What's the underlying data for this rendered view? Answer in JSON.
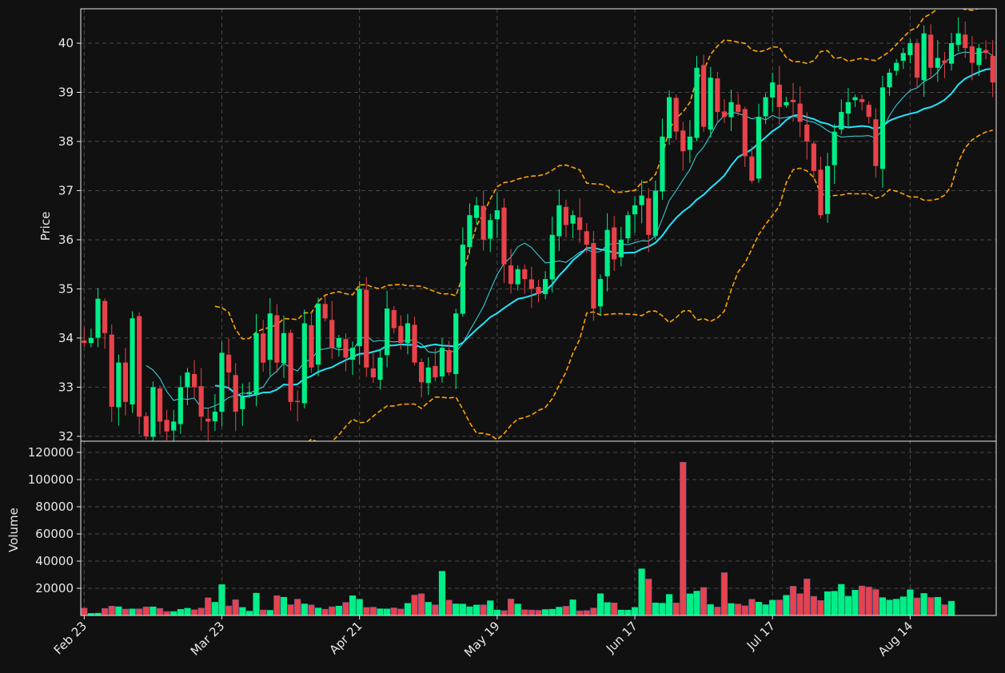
{
  "colors": {
    "background": "#111111",
    "grid": "#4a4a4a",
    "frame": "#e8e8e8",
    "up": "#00ee88",
    "down": "#e8424a",
    "ma_fast": "#39dce4",
    "ma_slow": "#22e6ff",
    "bands": "#ffa500"
  },
  "chart_data": {
    "type": "candlestick",
    "title": "",
    "grid": true,
    "price_panel": {
      "ylabel": "Price",
      "ylim": [
        31.9,
        40.7
      ],
      "yticks": [
        "32",
        "33",
        "34",
        "35",
        "36",
        "37",
        "38",
        "39",
        "40"
      ]
    },
    "volume_panel": {
      "ylabel": "Volume",
      "ylim": [
        0,
        120000
      ],
      "yticks": [
        "20000",
        "40000",
        "60000",
        "80000",
        "100000",
        "120000"
      ]
    },
    "x_ticks": [
      {
        "label": "Feb 23",
        "index": 0
      },
      {
        "label": "Mar 23",
        "index": 20
      },
      {
        "label": "Apr 21",
        "index": 40
      },
      {
        "label": "May 19",
        "index": 60
      },
      {
        "label": "Jun 17",
        "index": 80
      },
      {
        "label": "Jul 17",
        "index": 100
      },
      {
        "label": "Aug 14",
        "index": 120
      }
    ],
    "closes": [
      33.9,
      34.0,
      34.8,
      34.1,
      32.6,
      33.5,
      32.7,
      34.4,
      32.4,
      32.0,
      33.0,
      32.3,
      32.1,
      32.3,
      33.0,
      33.3,
      33.0,
      32.4,
      32.3,
      32.5,
      33.7,
      33.3,
      32.5,
      32.8,
      32.9,
      34.1,
      33.5,
      34.5,
      33.5,
      34.1,
      32.7,
      32.7,
      34.3,
      33.4,
      34.7,
      34.4,
      33.8,
      34.0,
      33.6,
      33.8,
      35.0,
      33.4,
      33.2,
      33.6,
      34.6,
      34.2,
      33.9,
      34.3,
      33.5,
      33.1,
      33.4,
      33.2,
      33.8,
      33.3,
      34.5,
      35.9,
      36.5,
      36.7,
      36.0,
      36.4,
      36.6,
      35.5,
      35.1,
      35.4,
      35.2,
      35.0,
      34.9,
      35.2,
      36.1,
      36.7,
      36.3,
      36.5,
      36.2,
      35.9,
      34.6,
      35.2,
      36.2,
      35.6,
      36.0,
      36.5,
      36.7,
      36.9,
      36.1,
      37.0,
      38.1,
      38.9,
      38.2,
      37.8,
      38.1,
      39.5,
      38.3,
      39.3,
      38.6,
      38.5,
      38.8,
      38.6,
      37.7,
      37.2,
      38.5,
      38.9,
      39.2,
      38.7,
      38.8,
      38.8,
      38.4,
      38.0,
      37.4,
      36.5,
      37.5,
      38.2,
      38.6,
      38.8,
      38.9,
      38.8,
      38.5,
      37.5,
      39.1,
      39.4,
      39.6,
      39.8,
      40.0,
      39.3,
      40.2,
      39.5,
      39.7,
      39.6,
      40.0,
      40.2,
      39.9,
      39.6,
      39.9,
      39.8,
      39.2
    ],
    "volumes": [
      5400,
      1500,
      1700,
      5200,
      6900,
      6400,
      4700,
      4800,
      4900,
      6300,
      6300,
      5200,
      2900,
      2900,
      4500,
      5300,
      4200,
      5400,
      13000,
      9700,
      22700,
      7000,
      11600,
      5900,
      3200,
      16400,
      4100,
      3800,
      14600,
      13400,
      7900,
      12000,
      8500,
      7800,
      5500,
      4600,
      6400,
      6900,
      9600,
      14500,
      11900,
      5900,
      6100,
      4900,
      4800,
      5600,
      4800,
      8900,
      15000,
      16000,
      9700,
      7800,
      32500,
      11300,
      8500,
      8400,
      6400,
      7700,
      7800,
      10800,
      4000,
      3600,
      12100,
      8400,
      4200,
      4000,
      3800,
      4400,
      4600,
      6100,
      6800,
      11500,
      3400,
      3600,
      5500,
      16000,
      9500,
      9200,
      4000,
      3900,
      5900,
      34300,
      26800,
      9200,
      9000,
      15500,
      9200,
      112800,
      15900,
      17900,
      20600,
      8000,
      6200,
      31500,
      8800,
      8400,
      7100,
      11900,
      9800,
      7900,
      11200,
      11400,
      14800,
      21500,
      16000,
      26900,
      14100,
      11000,
      17500,
      17800,
      22900,
      14100,
      18600,
      21700,
      20900,
      19100,
      13100,
      11300,
      12000,
      13700,
      18900,
      12900,
      16200,
      13200,
      13400,
      7900,
      10500
    ],
    "moving_averages": [
      {
        "window": 10,
        "style": "thin"
      },
      {
        "window": 20,
        "style": "thick"
      }
    ],
    "bollinger_bands": {
      "window": 20,
      "stdev": 2
    }
  }
}
